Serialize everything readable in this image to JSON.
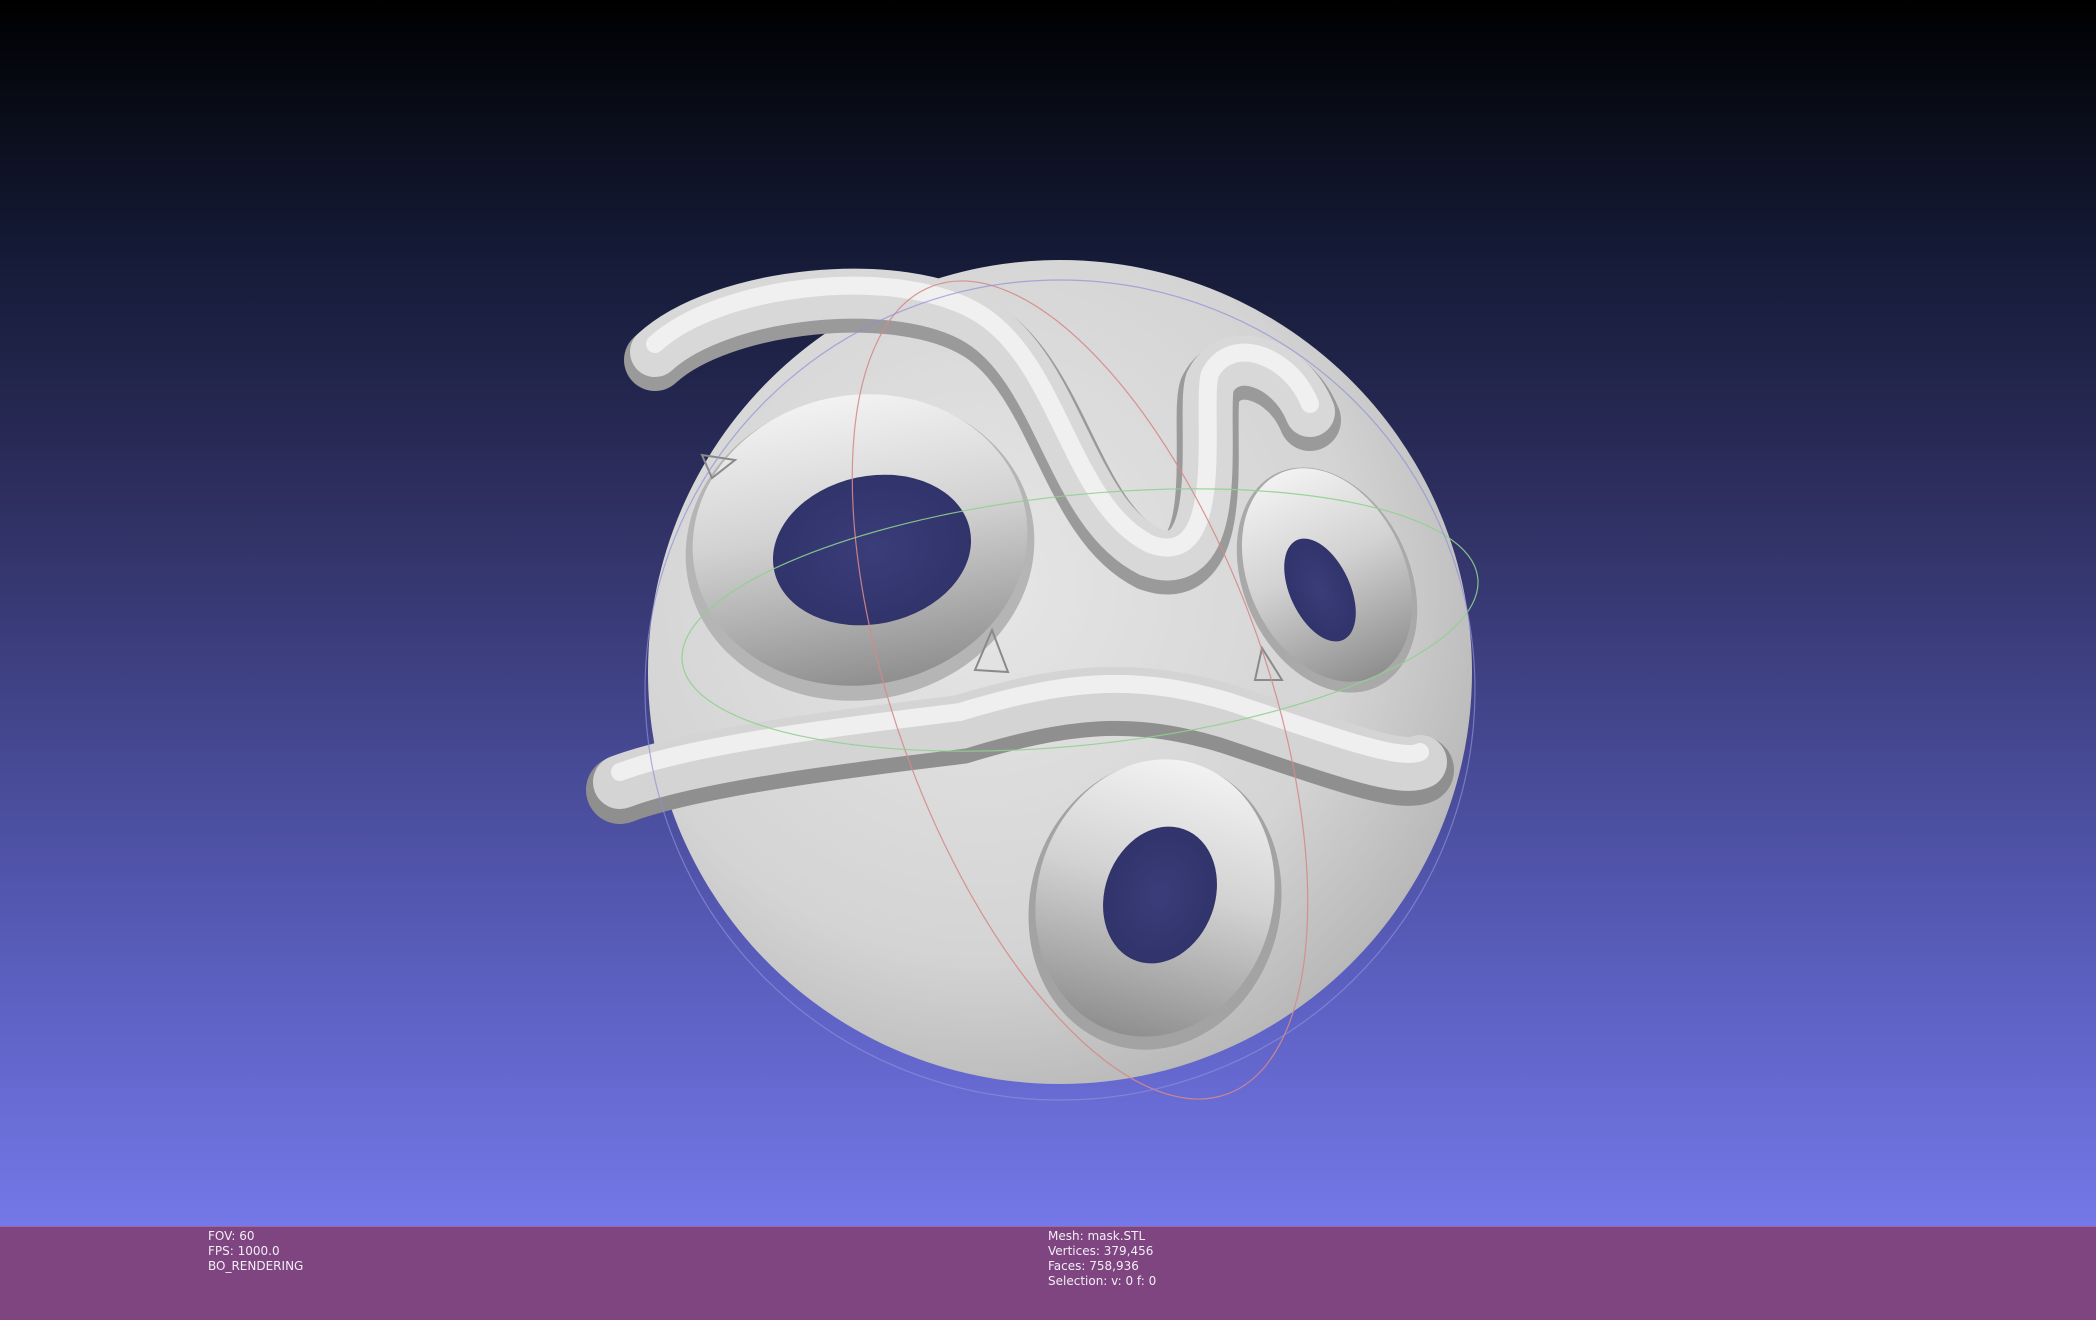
{
  "colors": {
    "background_top": "#000000",
    "background_bottom": "#7478e8",
    "info_bar": "#7e4581",
    "mesh": "#d6d6d6",
    "trackball_x": "#e08080",
    "trackball_y": "#80e080",
    "trackball_z": "#8080e0"
  },
  "viewport": {
    "mesh_description": "mask-shaped 3D model with swirl ridges and three eye/mouth holes",
    "trackball_visible": true
  },
  "status_left": {
    "fov": "FOV: 60",
    "fps": "FPS:  1000.0",
    "mode": "BO_RENDERING"
  },
  "status_right": {
    "mesh": "Mesh: mask.STL",
    "vertices": "Vertices: 379,456",
    "faces": "Faces: 758,936",
    "selection": "Selection: v: 0 f: 0"
  }
}
